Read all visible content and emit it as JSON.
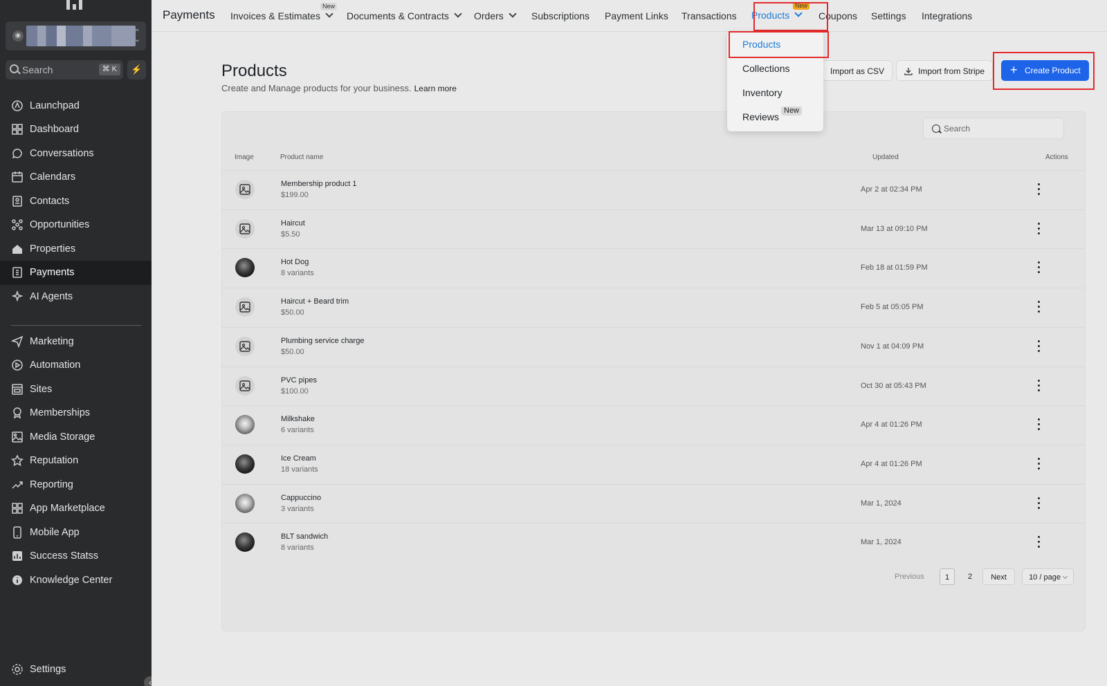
{
  "sidebar": {
    "search_placeholder": "Search",
    "search_shortcut": "⌘ K",
    "items_top": [
      {
        "label": "Launchpad",
        "icon": "rocket-icon"
      },
      {
        "label": "Dashboard",
        "icon": "grid-icon"
      },
      {
        "label": "Conversations",
        "icon": "chat-icon"
      },
      {
        "label": "Calendars",
        "icon": "calendar-icon"
      },
      {
        "label": "Contacts",
        "icon": "contacts-icon"
      },
      {
        "label": "Opportunities",
        "icon": "network-icon"
      },
      {
        "label": "Properties",
        "icon": "home-icon"
      },
      {
        "label": "Payments",
        "icon": "invoice-icon",
        "active": true
      },
      {
        "label": "AI Agents",
        "icon": "sparkle-icon"
      }
    ],
    "items_bottom": [
      {
        "label": "Marketing",
        "icon": "send-icon"
      },
      {
        "label": "Automation",
        "icon": "automation-icon"
      },
      {
        "label": "Sites",
        "icon": "sites-icon"
      },
      {
        "label": "Memberships",
        "icon": "badge-icon"
      },
      {
        "label": "Media Storage",
        "icon": "image-icon"
      },
      {
        "label": "Reputation",
        "icon": "star-icon"
      },
      {
        "label": "Reporting",
        "icon": "trend-icon"
      },
      {
        "label": "App Marketplace",
        "icon": "apps-icon"
      },
      {
        "label": "Mobile App",
        "icon": "phone-icon"
      },
      {
        "label": "Success Statss",
        "icon": "stats-icon"
      },
      {
        "label": "Knowledge Center",
        "icon": "info-icon"
      }
    ],
    "settings_label": "Settings"
  },
  "topbar": {
    "brand": "Payments",
    "tabs": [
      {
        "label": "Invoices & Estimates",
        "dropdown": true,
        "badge": "New"
      },
      {
        "label": "Documents & Contracts",
        "dropdown": true
      },
      {
        "label": "Orders",
        "dropdown": true
      },
      {
        "label": "Subscriptions"
      },
      {
        "label": "Payment Links"
      },
      {
        "label": "Transactions"
      },
      {
        "label": "Products",
        "dropdown": true,
        "badge": "New",
        "selected": true
      },
      {
        "label": "Coupons"
      },
      {
        "label": "Settings"
      },
      {
        "label": "Integrations"
      }
    ]
  },
  "dropdown": {
    "items": [
      {
        "label": "Products",
        "selected": true
      },
      {
        "label": "Collections"
      },
      {
        "label": "Inventory"
      },
      {
        "label": "Reviews",
        "badge": "New"
      }
    ]
  },
  "page": {
    "title": "Products",
    "subtitle": "Create and Manage products for your business.",
    "learn_more": "Learn more",
    "import_csv": "Import as CSV",
    "import_stripe": "Import from Stripe",
    "create": "Create Product",
    "search_placeholder": "Search"
  },
  "table": {
    "headers": {
      "image": "Image",
      "name": "Product name",
      "updated": "Updated",
      "actions": "Actions"
    },
    "rows": [
      {
        "name": "Membership product 1",
        "sub": "$199.00",
        "updated": "Apr 2 at 02:34 PM",
        "image": "placeholder"
      },
      {
        "name": "Haircut",
        "sub": "$5.50",
        "updated": "Mar 13 at 09:10 PM",
        "image": "placeholder"
      },
      {
        "name": "Hot Dog",
        "sub": "8 variants",
        "updated": "Feb 18 at 01:59 PM",
        "image": "photo"
      },
      {
        "name": "Haircut + Beard trim",
        "sub": "$50.00",
        "updated": "Feb 5 at 05:05 PM",
        "image": "placeholder"
      },
      {
        "name": "Plumbing service charge",
        "sub": "$50.00",
        "updated": "Nov 1 at 04:09 PM",
        "image": "placeholder"
      },
      {
        "name": "PVC pipes",
        "sub": "$100.00",
        "updated": "Oct 30 at 05:43 PM",
        "image": "placeholder"
      },
      {
        "name": "Milkshake",
        "sub": "6 variants",
        "updated": "Apr 4 at 01:26 PM",
        "image": "photo2"
      },
      {
        "name": "Ice Cream",
        "sub": "18 variants",
        "updated": "Apr 4 at 01:26 PM",
        "image": "photo"
      },
      {
        "name": "Cappuccino",
        "sub": "3 variants",
        "updated": "Mar 1, 2024",
        "image": "photo2"
      },
      {
        "name": "BLT sandwich",
        "sub": "8 variants",
        "updated": "Mar 1, 2024",
        "image": "photo"
      }
    ]
  },
  "pagination": {
    "previous": "Previous",
    "pages": [
      "1",
      "2"
    ],
    "next": "Next",
    "per_page": "10 / page"
  },
  "colors": {
    "accent": "#1d64e9",
    "highlight": "#e3292b",
    "sidebar_bg": "#2a2b2d"
  }
}
